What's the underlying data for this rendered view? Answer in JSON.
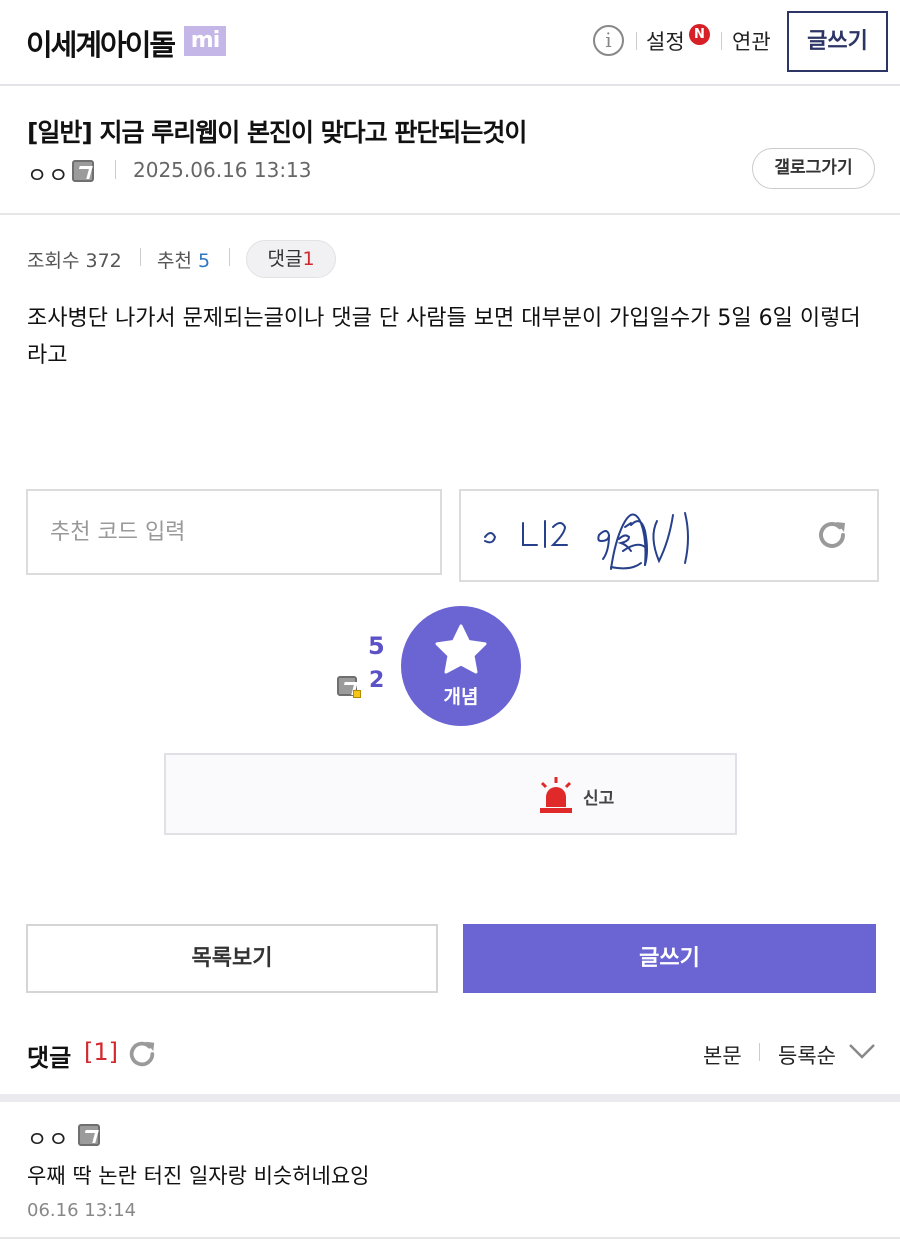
{
  "header": {
    "gallery_name": "이세계아이돌",
    "gallery_badge": "mi",
    "info_icon": "info-icon",
    "settings_label": "설정",
    "new_badge": "N",
    "related_label": "연관",
    "write_label": "글쓰기"
  },
  "post": {
    "title": "[일반] 지금 루리웹이 본진이 맞다고 판단되는것이",
    "author": "ㅇㅇ",
    "date": "2025.06.16 13:13",
    "gallery_go_label": "갤로그가기",
    "views_label": "조회수 372",
    "recommend_label": "추천",
    "recommend_count": "5",
    "comment_label": "댓글",
    "comment_count": "1",
    "body": "조사병단 나가서 문제되는글이나 댓글 단 사람들 보면 대부분이 가입일수가 5일 6일 이렇더라고"
  },
  "recommend": {
    "code_placeholder": "추천 코드 입력",
    "captcha_refresh_icon": "refresh-icon",
    "vote_count": "5",
    "fixed_count": "2",
    "vote_label": "개념",
    "report_label": "신고"
  },
  "actions": {
    "list_label": "목록보기",
    "write_label": "글쓰기"
  },
  "comments": {
    "title": "댓글",
    "count": "[1]",
    "view_body_label": "본문",
    "order_label": "등록순",
    "items": [
      {
        "author": "ㅇㅇ",
        "text": "우째 딱 논란 터진 일자랑 비슷허네요잉",
        "date": "06.16 13:14"
      }
    ]
  },
  "colors": {
    "accent": "#6b65d4",
    "header_border": "#2d3566",
    "badge": "#c4b6e6",
    "red": "#d3282e",
    "blue": "#2e76c3"
  }
}
